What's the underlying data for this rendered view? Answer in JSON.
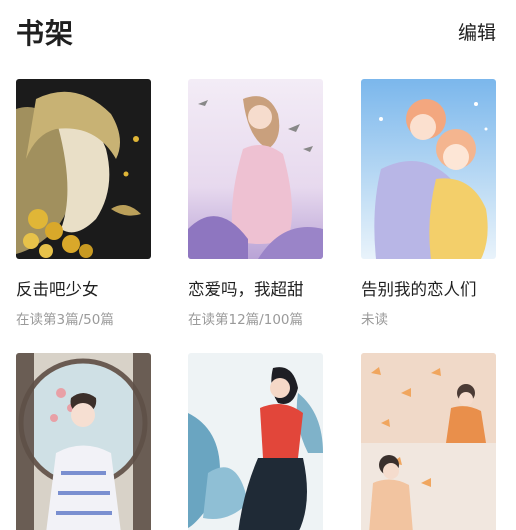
{
  "header": {
    "title": "书架",
    "edit_label": "编辑"
  },
  "books": [
    {
      "title": "反击吧少女",
      "progress": "在读第3篇/50篇"
    },
    {
      "title": "恋爱吗，我超甜",
      "progress": "在读第12篇/100篇"
    },
    {
      "title": "告别我的恋人们",
      "progress": "未读"
    },
    {
      "title": "",
      "progress": ""
    },
    {
      "title": "",
      "progress": ""
    },
    {
      "title": "",
      "progress": ""
    }
  ]
}
